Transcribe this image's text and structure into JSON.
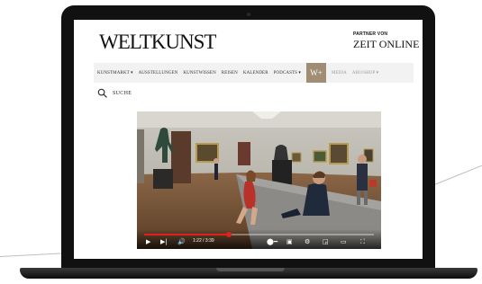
{
  "site": {
    "logo": "WELTKUNST",
    "partner_label": "PARTNER VON",
    "partner_brand": "ZEIT ONLINE"
  },
  "nav": {
    "items": [
      {
        "label": "KUNSTMARKT ▾"
      },
      {
        "label": "AUSSTELLUNGEN"
      },
      {
        "label": "KUNSTWISSEN"
      },
      {
        "label": "REISEN"
      },
      {
        "label": "KALENDER"
      },
      {
        "label": "PODCASTS ▾"
      }
    ],
    "badge": "W+",
    "trailing": [
      {
        "label": "MEDIA"
      },
      {
        "label": "ABO/SHOP ▾"
      }
    ]
  },
  "search": {
    "label": "SUCHE",
    "icon": "magnifier"
  },
  "video": {
    "time": "1:22 / 3:39",
    "progress": 0.37,
    "accent": "#e0201c"
  }
}
